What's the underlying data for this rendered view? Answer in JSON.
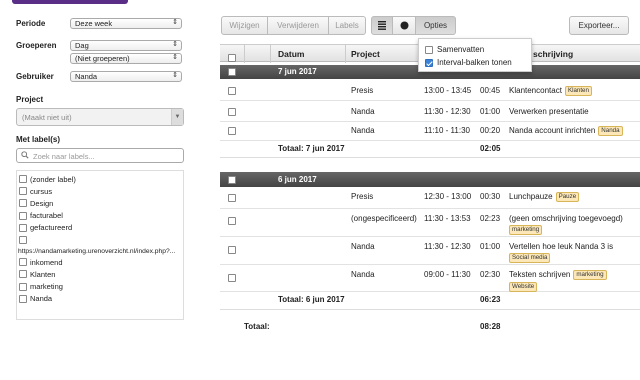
{
  "filters": {
    "periode": {
      "label": "Periode",
      "value": "Deze week"
    },
    "groeperen": {
      "label": "Groeperen",
      "value": "Dag",
      "value2": "(Niet groeperen)"
    },
    "gebruiker": {
      "label": "Gebruiker",
      "value": "Nanda"
    },
    "project": {
      "label": "Project",
      "placeholder": "(Maakt niet uit)"
    },
    "labels": {
      "label": "Met label(s)",
      "search_placeholder": "Zoek naar labels...",
      "items": [
        "(zonder label)",
        "cursus",
        "Design",
        "facturabel",
        "gefactureerd",
        "",
        "inkomend",
        "Klanten",
        "marketing",
        "Nanda"
      ],
      "url_text": "https://nandamarketing.urenoverzicht.nl/index.php?..."
    }
  },
  "toolbar": {
    "wijzigen": "Wijzigen",
    "verwijderen": "Verwijderen",
    "labels": "Labels",
    "opties": "Opties",
    "exporteer": "Exporteer..."
  },
  "options_menu": {
    "samenvatten": "Samenvatten",
    "interval": "Interval-balken tonen"
  },
  "table": {
    "headers": {
      "datum": "Datum",
      "project": "Project",
      "omschrijving": "schrijving"
    },
    "groups": [
      {
        "date": "7 jun 2017",
        "rows": [
          {
            "project": "Presis",
            "time": "13:00 - 13:45",
            "dur": "00:45",
            "desc": "Klantencontact",
            "tags": [
              "Klanten"
            ]
          },
          {
            "project": "Nanda",
            "time": "11:30 - 12:30",
            "dur": "01:00",
            "desc": "Verwerken presentatie",
            "tags": []
          },
          {
            "project": "Nanda",
            "time": "11:10 - 11:30",
            "dur": "00:20",
            "desc": "Nanda account inrichten",
            "tags": [
              "Nanda"
            ]
          }
        ],
        "total_label": "Totaal: 7 jun 2017",
        "total": "02:05"
      },
      {
        "date": "6 jun 2017",
        "rows": [
          {
            "project": "Presis",
            "time": "12:30 - 13:00",
            "dur": "00:30",
            "desc": "Lunchpauze",
            "tags": [
              "Pauze"
            ]
          },
          {
            "project": "(ongespecificeerd)",
            "time": "11:30 - 13:53",
            "dur": "02:23",
            "desc": "(geen omschrijving toegevoegd)",
            "tags": [
              "marketing"
            ]
          },
          {
            "project": "Nanda",
            "time": "11:30 - 12:30",
            "dur": "01:00",
            "desc": "Vertellen hoe leuk Nanda 3 is",
            "tags": [
              "Social media"
            ]
          },
          {
            "project": "Nanda",
            "time": "09:00 - 11:30",
            "dur": "02:30",
            "desc": "Teksten schrijven",
            "tags": [
              "marketing",
              "Website"
            ]
          }
        ],
        "total_label": "Totaal: 6 jun 2017",
        "total": "06:23"
      }
    ],
    "grand_total_label": "Totaal:",
    "grand_total": "08:28"
  }
}
